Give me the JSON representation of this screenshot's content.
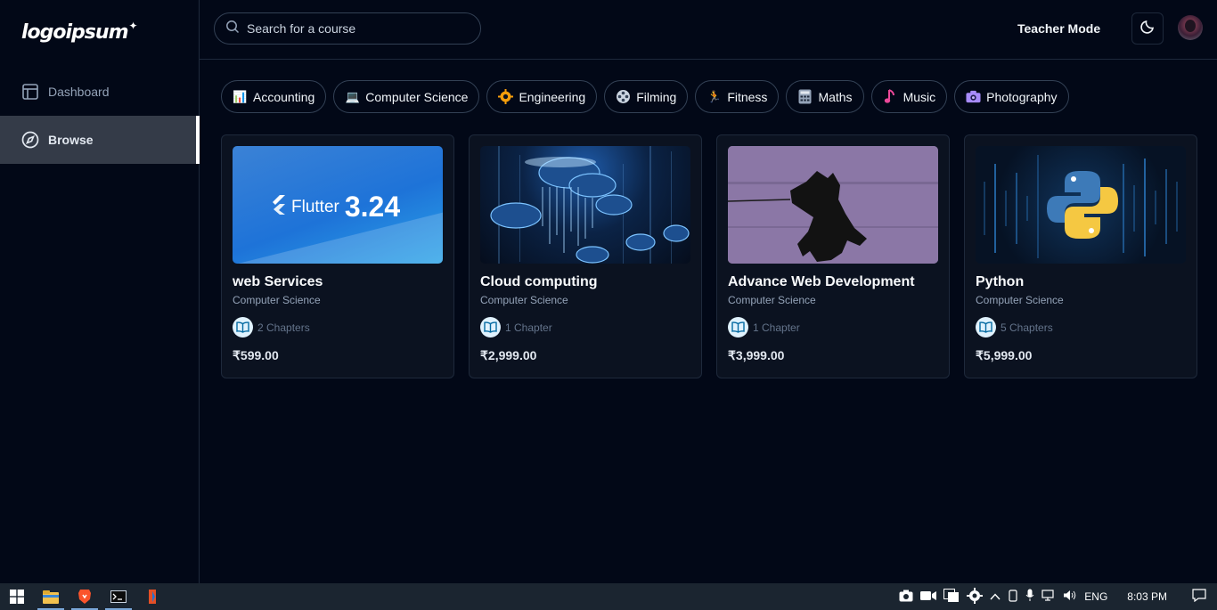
{
  "brand": {
    "logo_text": "logoipsum",
    "logo_mark": "✦"
  },
  "sidebar": {
    "items": [
      {
        "label": "Dashboard",
        "icon": "layout-icon",
        "active": false
      },
      {
        "label": "Browse",
        "icon": "compass-icon",
        "active": true
      }
    ]
  },
  "header": {
    "search_placeholder": "Search for a course",
    "teacher_mode_label": "Teacher Mode",
    "theme_icon": "moon-icon"
  },
  "categories": [
    {
      "label": "Accounting",
      "icon": "📊"
    },
    {
      "label": "Computer Science",
      "icon": "💻"
    },
    {
      "label": "Engineering",
      "icon": "⚙"
    },
    {
      "label": "Filming",
      "icon": "🎞"
    },
    {
      "label": "Fitness",
      "icon": "🏃"
    },
    {
      "label": "Maths",
      "icon": "🧮"
    },
    {
      "label": "Music",
      "icon": "♪"
    },
    {
      "label": "Photography",
      "icon": "📷"
    }
  ],
  "courses": [
    {
      "title": "web Services",
      "category": "Computer Science",
      "chapters": "2 Chapters",
      "price": "₹599.00",
      "thumb_text": "Flutter",
      "thumb_version": "3.24"
    },
    {
      "title": "Cloud computing",
      "category": "Computer Science",
      "chapters": "1 Chapter",
      "price": "₹2,999.00"
    },
    {
      "title": "Advance Web Development",
      "category": "Computer Science",
      "chapters": "1 Chapter",
      "price": "₹3,999.00"
    },
    {
      "title": "Python",
      "category": "Computer Science",
      "chapters": "5 Chapters",
      "price": "₹5,999.00"
    }
  ],
  "taskbar": {
    "language": "ENG",
    "time": "8:03 PM"
  },
  "colors": {
    "background": "#020817",
    "active_nav": "#343b48",
    "border": "#1e293b"
  }
}
